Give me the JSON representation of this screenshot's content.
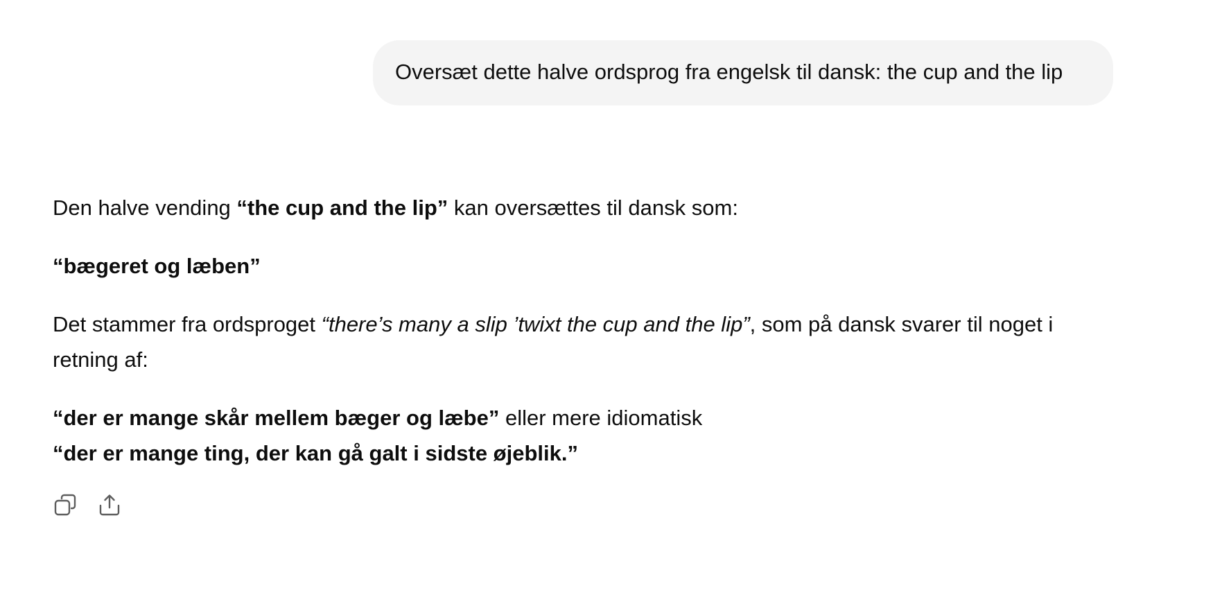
{
  "user_message": {
    "text": "Oversæt dette halve ordsprog fra engelsk til dansk: the cup and the lip"
  },
  "assistant_message": {
    "p1": {
      "before": "Den halve vending ",
      "bold": "“the cup and the lip”",
      "after": " kan oversættes til dansk som:"
    },
    "p2": {
      "bold": "“bægeret og læben”"
    },
    "p3": {
      "before": "Det stammer fra ordsproget ",
      "italic": "“there’s many a slip ’twixt the cup and the lip”",
      "after": ", som på dansk svarer til noget i retning af:"
    },
    "p4": {
      "bold1": "“der er mange skår mellem bæger og læbe”",
      "middle": " eller mere idiomatisk",
      "bold2": "“der er mange ting, der kan gå galt i sidste øjeblik.”"
    }
  },
  "actions": {
    "copy_icon": "copy-icon",
    "share_icon": "share-icon"
  },
  "colors": {
    "bubble_bg": "#f4f4f4",
    "text": "#0d0d0d",
    "icon": "#5d5d5d"
  }
}
